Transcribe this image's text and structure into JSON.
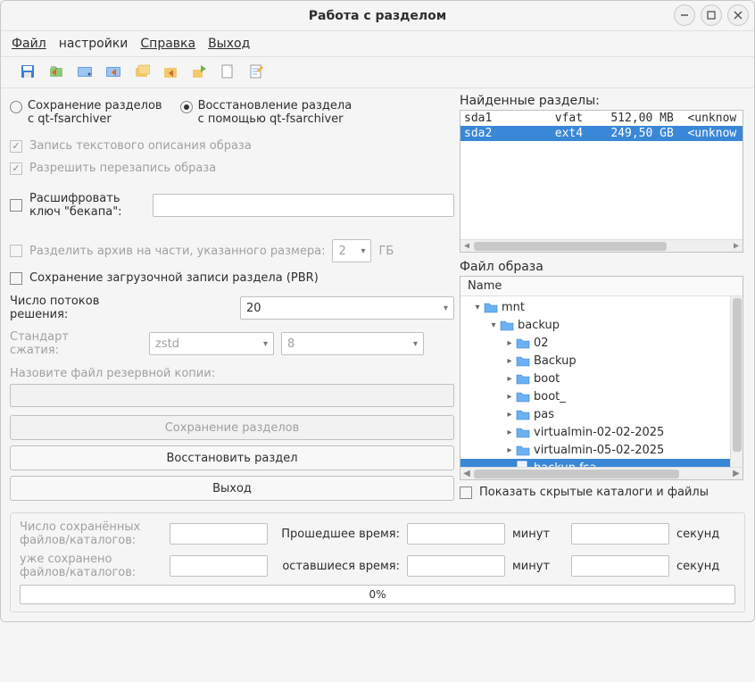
{
  "window": {
    "title": "Работа с разделом"
  },
  "menu": {
    "file": "Файл",
    "settings": "настройки",
    "help": "Справка",
    "exit": "Выход"
  },
  "left": {
    "radio_save": "Сохранение разделов\nс qt-fsarchiver",
    "radio_restore": "Восстановление раздела\nс помощью qt-fsarchiver",
    "chk_write_desc": "Запись текстового описания образа",
    "chk_allow_overwrite": "Разрешить перезапись образа",
    "decrypt_label": "Расшифровать\nключ \"бекапа\":",
    "chk_split": "Разделить архив на части, указанного размера:",
    "split_value": "2",
    "split_unit": "ГБ",
    "chk_pbr": "Сохранение загрузочной записи раздела (PBR)",
    "threads_label": "Число потоков\nрешения:",
    "threads_value": "20",
    "compress_label": "Стандарт\nсжатия:",
    "compress_algo": "zstd",
    "compress_level": "8",
    "backup_name_label": "Назовите файл резервной копии:",
    "btn_save": "Сохранение разделов",
    "btn_restore": "Восстановить раздел",
    "btn_exit": "Выход"
  },
  "right": {
    "found_label": "Найденные разделы:",
    "partitions": [
      {
        "dev": "sda1",
        "fs": "vfat",
        "size": "512,00 MB",
        "extra": "<unknow",
        "selected": false
      },
      {
        "dev": "sda2",
        "fs": "ext4",
        "size": "249,50 GB",
        "extra": "<unknow",
        "selected": true
      }
    ],
    "image_file_label": "Файл образа",
    "name_header": "Name",
    "chk_show_hidden": "Показать скрытые каталоги и файлы",
    "tree": [
      {
        "depth": 0,
        "type": "folder",
        "expander": "down",
        "label": "mnt",
        "selected": false
      },
      {
        "depth": 1,
        "type": "folder",
        "expander": "down",
        "label": "backup",
        "selected": false
      },
      {
        "depth": 2,
        "type": "folder",
        "expander": "right",
        "label": "02",
        "selected": false
      },
      {
        "depth": 2,
        "type": "folder",
        "expander": "right",
        "label": "Backup",
        "selected": false
      },
      {
        "depth": 2,
        "type": "folder",
        "expander": "right",
        "label": "boot",
        "selected": false
      },
      {
        "depth": 2,
        "type": "folder",
        "expander": "right",
        "label": "boot_",
        "selected": false
      },
      {
        "depth": 2,
        "type": "folder",
        "expander": "right",
        "label": "pas",
        "selected": false
      },
      {
        "depth": 2,
        "type": "folder",
        "expander": "right",
        "label": "virtualmin-02-02-2025",
        "selected": false
      },
      {
        "depth": 2,
        "type": "folder",
        "expander": "right",
        "label": "virtualmin-05-02-2025",
        "selected": false
      },
      {
        "depth": 2,
        "type": "file",
        "expander": "none",
        "label": "backup.fsa",
        "selected": true
      }
    ]
  },
  "status": {
    "saved_label": "Число сохранённых\nфайлов/каталогов:",
    "already_saved_label": "уже сохранено\nфайлов/каталогов:",
    "elapsed_label": "Прошедшее время:",
    "remaining_label": "оставшиеся время:",
    "minutes": "минут",
    "seconds": "секунд",
    "progress": "0%"
  }
}
